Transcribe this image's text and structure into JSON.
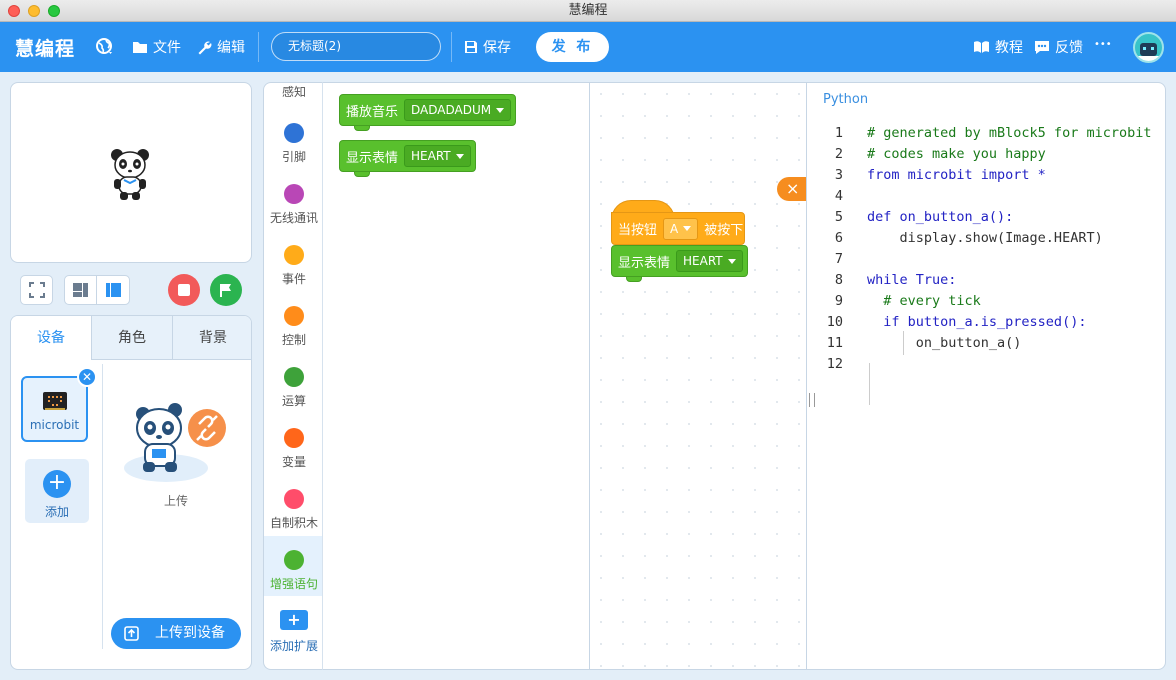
{
  "window": {
    "title": "慧编程"
  },
  "topbar": {
    "brand": "慧编程",
    "file_label": "文件",
    "edit_label": "编辑",
    "project_name": "无标题(2)",
    "save_label": "保存",
    "publish_label": "发 布",
    "tutorial_label": "教程",
    "feedback_label": "反馈",
    "more_label": "•••"
  },
  "device_panel": {
    "tabs": [
      "设备",
      "角色",
      "背景"
    ],
    "active_tab": "设备",
    "device_name": "microbit",
    "add_label": "添加",
    "upload_caption": "上传",
    "upload_button": "上传到设备"
  },
  "categories": [
    {
      "label": "感知",
      "color": "#4cbfe6"
    },
    {
      "label": "引脚",
      "color": "#2e73d6"
    },
    {
      "label": "无线通讯",
      "color": "#b947b6"
    },
    {
      "label": "事件",
      "color": "#ffab19"
    },
    {
      "label": "控制",
      "color": "#ff8c1a"
    },
    {
      "label": "运算",
      "color": "#3ea23a"
    },
    {
      "label": "变量",
      "color": "#ff661a"
    },
    {
      "label": "自制积木",
      "color": "#ff4d6a"
    },
    {
      "label": "增强语句",
      "color": "#4cb232"
    },
    {
      "label": "添加扩展",
      "color": "#2b92f1"
    }
  ],
  "active_category": "增强语句",
  "palette_blocks": [
    {
      "label": "播放音乐",
      "value": "DADADADUM"
    },
    {
      "label": "显示表情",
      "value": "HEART"
    }
  ],
  "workspace": {
    "hat_label_before": "当按钮",
    "hat_value": "A",
    "hat_label_after": "被按下",
    "stack_block_label": "显示表情",
    "stack_block_value": "HEART",
    "close_icon": "×"
  },
  "code_panel": {
    "title": "Python",
    "lines": [
      "# generated by mBlock5 for microbit",
      "# codes make you happy",
      "from microbit import *",
      "",
      "def on_button_a():",
      "    display.show(Image.HEART)",
      "",
      "while True:",
      "  # every tick",
      "  if button_a.is_pressed():",
      "      on_button_a()",
      ""
    ]
  },
  "colors": {
    "accent": "#2b92f1",
    "block_green": "#59c02d",
    "block_orange": "#ffab19",
    "stop": "#f25a5a",
    "go": "#2bb450"
  }
}
